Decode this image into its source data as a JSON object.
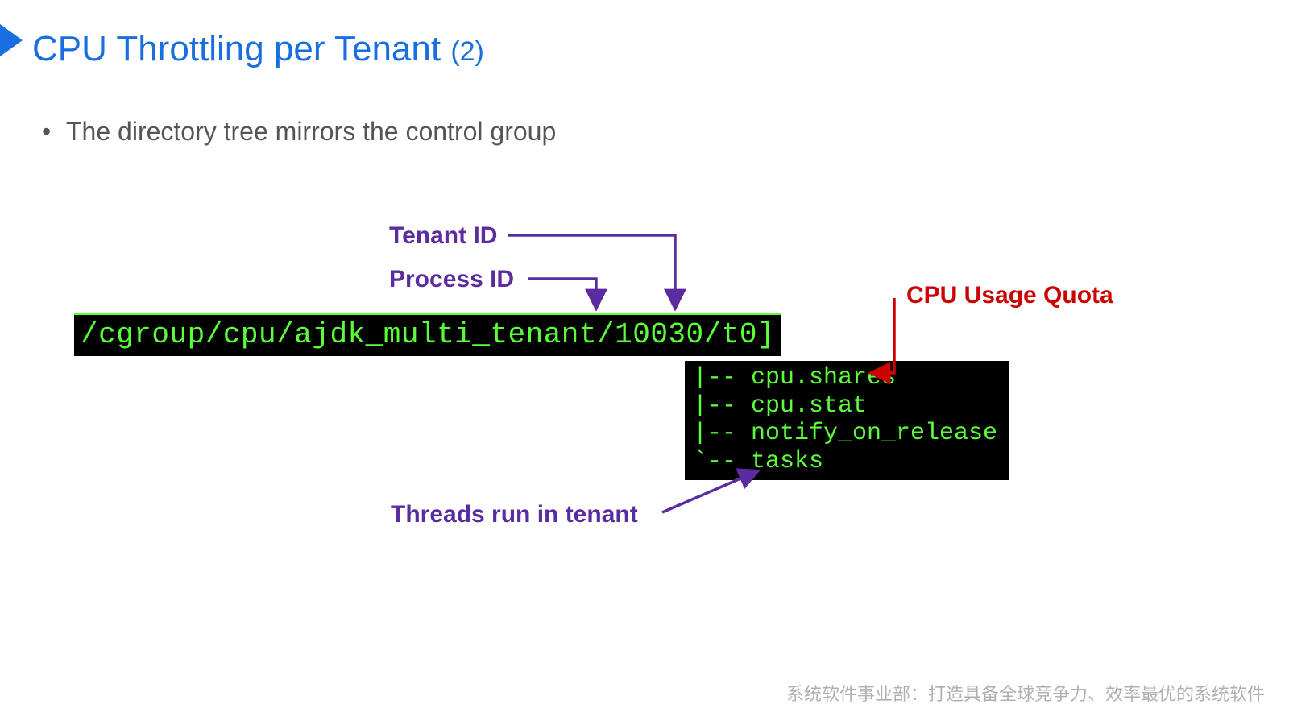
{
  "title": {
    "main": "CPU Throttling per Tenant ",
    "suffix": "(2)"
  },
  "bullet": "The directory tree mirrors the control group",
  "labels": {
    "tenant_id": "Tenant ID",
    "process_id": "Process ID",
    "cpu_quota": "CPU Usage Quota",
    "threads": "Threads run in tenant"
  },
  "terminal": {
    "path": "/cgroup/cpu/ajdk_multi_tenant/10030/t0]",
    "tree": "|-- cpu.shares\n|-- cpu.stat\n|-- notify_on_release\n`-- tasks"
  },
  "footer": "系统软件事业部：打造具备全球竞争力、效率最优的系统软件"
}
